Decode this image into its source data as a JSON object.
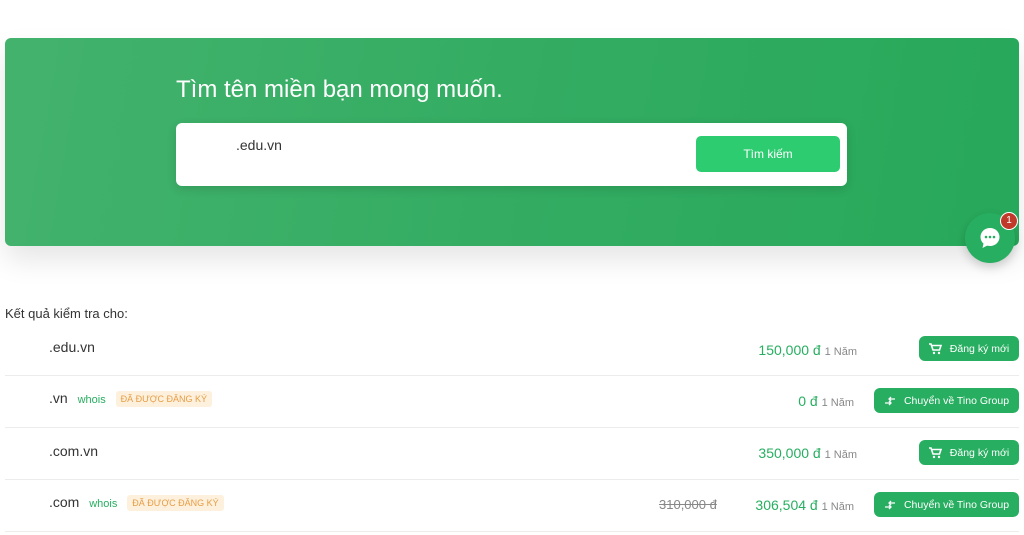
{
  "hero": {
    "title": "Tìm tên miền bạn mong muốn.",
    "search_value": ".edu.vn",
    "search_button": "Tìm kiếm"
  },
  "chat": {
    "badge_count": "1"
  },
  "results": {
    "heading": "Kết quả kiểm tra cho:",
    "rows": [
      {
        "domain": ".edu.vn",
        "price": "150,000 đ",
        "period": "1 Năm",
        "action": "Đăng ký mới",
        "action_icon": "cart-icon"
      },
      {
        "domain": ".vn",
        "whois": "whois",
        "status": "ĐÃ ĐƯỢC ĐĂNG KÝ",
        "price": "0 đ",
        "period": "1 Năm",
        "action": "Chuyển về Tino Group",
        "action_icon": "transfer-icon"
      },
      {
        "domain": ".com.vn",
        "price": "350,000 đ",
        "period": "1 Năm",
        "action": "Đăng ký mới",
        "action_icon": "cart-icon"
      },
      {
        "domain": ".com",
        "whois": "whois",
        "status": "ĐÃ ĐƯỢC ĐĂNG KÝ",
        "old_price": "310,000 đ",
        "price": "306,504 đ",
        "period": "1 Năm",
        "action": "Chuyển về Tino Group",
        "action_icon": "transfer-icon"
      }
    ]
  },
  "colors": {
    "accent": "#27ae60",
    "button": "#2ecc71",
    "badge_bg": "#fdf0dd",
    "badge_text": "#e79e45"
  }
}
